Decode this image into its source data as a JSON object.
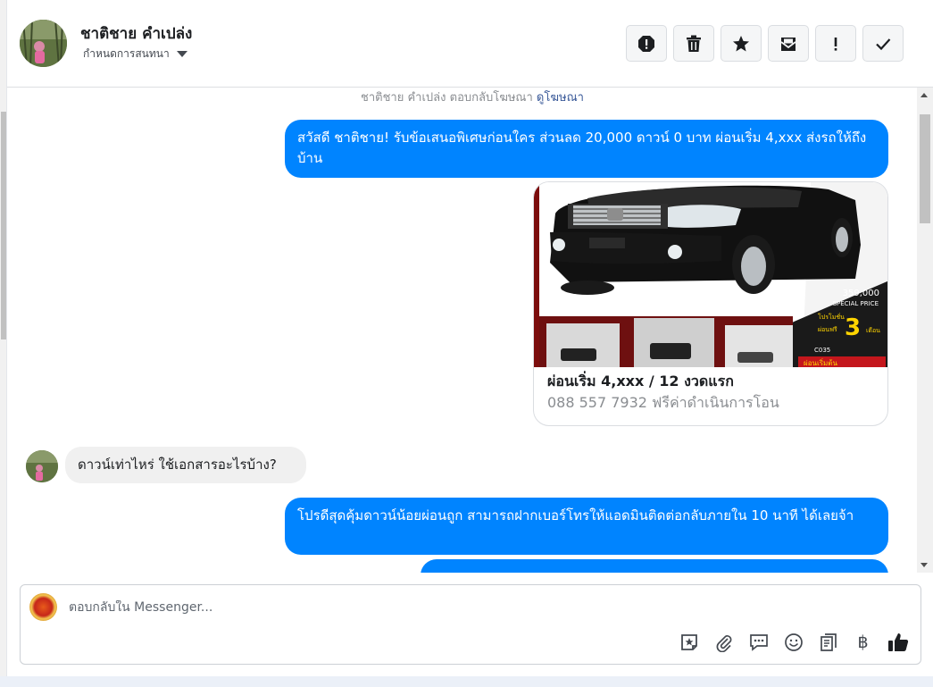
{
  "header": {
    "contact_name": "ชาติชาย คำเปล่ง",
    "assign_label": "กำหนดการสนทนา",
    "actions": [
      "spam-icon",
      "trash-icon",
      "star-icon",
      "mail-icon",
      "important-icon",
      "check-icon"
    ]
  },
  "thread": {
    "system_note": "ชาติชาย คำเปล่ง ตอบกลับโฆษณา",
    "system_link": "ดูโฆษณา",
    "messages": [
      {
        "from": "page",
        "text": "สวัสดี ชาติชาย! รับข้อเสนอพิเศษก่อนใคร ส่วนลด 20,000 ดาวน์ 0 บาท ผ่อนเริ่ม 4,xxx ส่งรถให้ถึงบ้าน"
      },
      {
        "from": "page",
        "type": "card",
        "title": "ผ่อนเริ่ม 4,xxx / 12 งวดแรก",
        "subtitle": "088 557 7932 ฟรีค่าดำเนินการโอน"
      },
      {
        "from": "user",
        "text": "ดาวน์เท่าไหร่ ใช้เอกสารอะไรบ้าง?"
      },
      {
        "from": "page",
        "text": "โปรดีสุดคุ้มดาวน์น้อยผ่อนถูก สามารถฝากเบอร์โทรให้แอดมินติดต่อกลับภายใน 10 นาที ได้เลยจ้า"
      }
    ],
    "card_image": {
      "price": "359,000",
      "price_label": "SPECIAL PRICE",
      "promo_label": "โปรโมชั่น",
      "promo_free": "ผ่อนฟรี",
      "promo_months": "3",
      "promo_unit": "เดือน",
      "code": "C035",
      "band_text": "ผ่อนเริ่มต้น"
    }
  },
  "composer": {
    "placeholder": "ตอบกลับใน Messenger...",
    "value": "",
    "tools": [
      "sticker-icon",
      "attachment-icon",
      "saved-reply-icon",
      "emoji-icon",
      "notes-icon",
      "payment-icon",
      "like-icon"
    ],
    "payment_symbol": "฿"
  }
}
